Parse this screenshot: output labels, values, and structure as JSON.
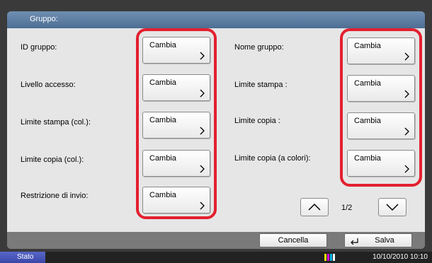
{
  "header": {
    "title": "Gruppo:"
  },
  "fields": [
    {
      "label": "ID gruppo:",
      "button": "Cambia"
    },
    {
      "label": "Nome gruppo:",
      "button": "Cambia"
    },
    {
      "label": "Livello accesso:",
      "button": "Cambia"
    },
    {
      "label": "Limite stampa :",
      "button": "Cambia"
    },
    {
      "label": "Limite stampa (col.):",
      "button": "Cambia"
    },
    {
      "label": "Limite copia :",
      "button": "Cambia"
    },
    {
      "label": "Limite copia (col.):",
      "button": "Cambia"
    },
    {
      "label": "Limite copia (a colori):",
      "button": "Cambia"
    },
    {
      "label": "Restrizione di invio:",
      "button": "Cambia"
    }
  ],
  "pager": {
    "indicator": "1/2"
  },
  "footer": {
    "cancel_label": "Cancella",
    "save_label": "Salva"
  },
  "status": {
    "label": "Stato",
    "datetime": "10/10/2010  10:10"
  },
  "colors": {
    "header": "#5a7aa0",
    "highlight": "#e3202f",
    "panel": "#e6e6e6",
    "status": "#3b47a8"
  }
}
